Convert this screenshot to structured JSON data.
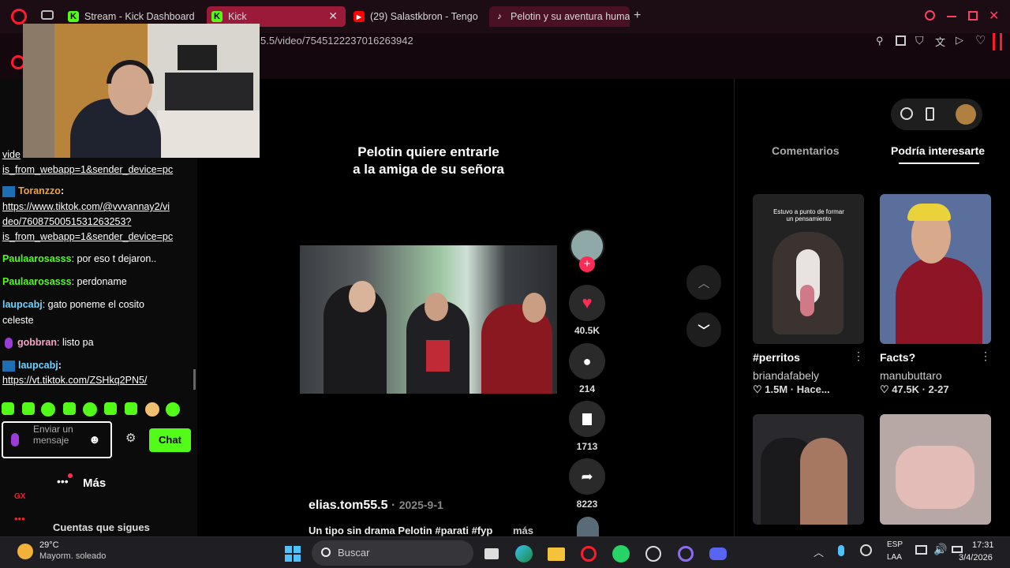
{
  "colors": {
    "kick_green": "#53fc18",
    "tiktok_red": "#fe2c55",
    "opera_red": "#ff1b2d"
  },
  "browser": {
    "tabs": [
      {
        "label": "Stream - Kick Dashboard",
        "icon": "kick-icon"
      },
      {
        "label": "Kick",
        "icon": "kick-icon"
      },
      {
        "label": "(29) Salastkbron - Tengo",
        "icon": "youtube-icon"
      },
      {
        "label": "Pelotin y su aventura huma",
        "icon": "tiktok-icon"
      }
    ],
    "url": "5.5/video/7545122237016263942"
  },
  "chat": {
    "messages": [
      {
        "user": "",
        "text": "vide",
        "link": true
      },
      {
        "user": "",
        "text": "is_from_webapp=1&sender_device=pc",
        "link": true
      },
      {
        "user": "Toranzzo",
        "color": "#f0a03c",
        "text": "",
        "link": false
      },
      {
        "user": "",
        "text": "https://www.tiktok.com/@vvvannay2/vi",
        "link": true
      },
      {
        "user": "",
        "text": "deo/7608750051531263253?",
        "link": true
      },
      {
        "user": "",
        "text": "is_from_webapp=1&sender_device=pc",
        "link": true
      },
      {
        "user": "Paulaarosasss",
        "color": "#53fc18",
        "text": ": por eso t dejaron..",
        "link": false
      },
      {
        "user": "Paulaarosasss",
        "color": "#53fc18",
        "text": ": perdoname",
        "link": false
      },
      {
        "user": "laupcabj",
        "color": "#6fd3ff",
        "text": ": gato poneme el cosito",
        "link": false
      },
      {
        "user": "",
        "text": "celeste",
        "link": false
      },
      {
        "user": "gobbran",
        "color": "#f5a3c8",
        "text": ": listo pa",
        "link": false
      },
      {
        "user": "laupcabj",
        "color": "#6fd3ff",
        "text": ":",
        "link": false
      },
      {
        "user": "",
        "text": "https://vt.tiktok.com/ZSHkq2PN5/",
        "link": true
      }
    ],
    "input_placeholder": "Enviar un mensaje",
    "chat_button": "Chat"
  },
  "leftnav": {
    "more_label": "Más",
    "following_label": "Cuentas que sigues",
    "gx_label": "GX"
  },
  "video": {
    "caption_line1": "Pelotin quiere entrarle",
    "caption_line2": "a la amiga de su señora",
    "author": "elias.tom55.5",
    "date": "2025-9-1",
    "description": "Un tipo sin drama Pelotin #parati #fyp",
    "more": "más",
    "likes": "40.5K",
    "comments": "214",
    "saves": "1713",
    "shares": "8223"
  },
  "side": {
    "tabs": [
      "Comentarios",
      "Podría interesarte"
    ],
    "cards": [
      {
        "title": "#perritos",
        "author": "briandafabely",
        "likes": "1.5M",
        "meta": "Hace...",
        "overlay": "Estuvo a punto de formar un pensamiento"
      },
      {
        "title": "Facts?",
        "author": "manubuttaro",
        "likes": "47.5K",
        "meta": "2-27",
        "overlay": ""
      },
      {
        "title": "",
        "author": "",
        "likes": "",
        "meta": "",
        "overlay": ""
      },
      {
        "title": "",
        "author": "",
        "likes": "",
        "meta": "",
        "overlay": ""
      }
    ]
  },
  "taskbar": {
    "weather_temp": "29°C",
    "weather_desc": "Mayorm. soleado",
    "search_placeholder": "Buscar",
    "lang1": "ESP",
    "lang2": "LAA",
    "time": "17:31",
    "date": "3/4/2026"
  }
}
